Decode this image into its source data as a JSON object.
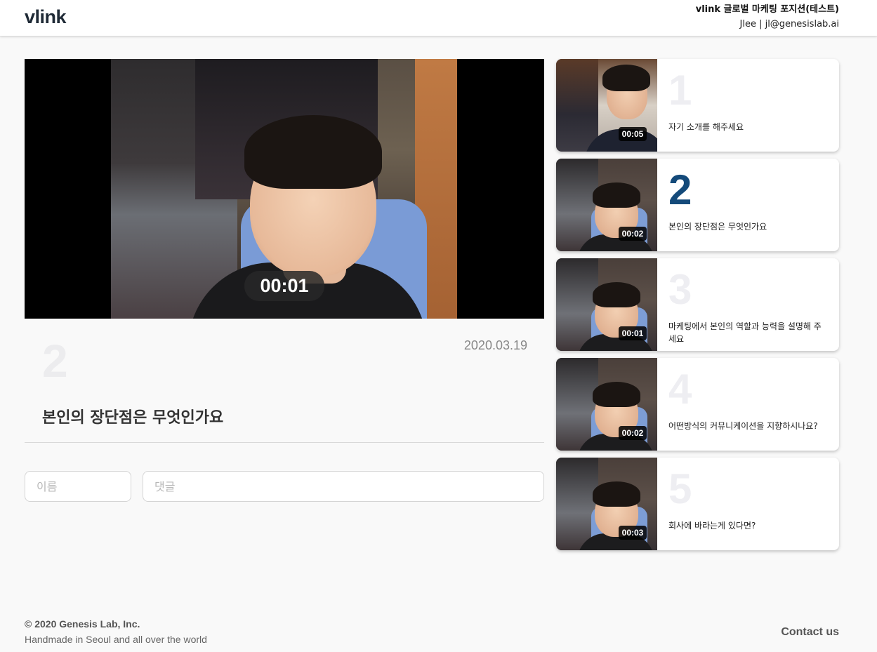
{
  "header": {
    "logo": "vlink",
    "title": "vlink 글로벌 마케팅 포지션(테스트)",
    "user": "Jlee | jl@genesislab.ai"
  },
  "player": {
    "timer": "00:01"
  },
  "question": {
    "number": "2",
    "date": "2020.03.19",
    "title": "본인의 장단점은 무엇인가요"
  },
  "comment_form": {
    "name_placeholder": "이름",
    "comment_placeholder": "댓글"
  },
  "cards": [
    {
      "number": "1",
      "duration": "00:05",
      "text": "자기 소개를 해주세요",
      "active": false
    },
    {
      "number": "2",
      "duration": "00:02",
      "text": "본인의 장단점은 무엇인가요",
      "active": true
    },
    {
      "number": "3",
      "duration": "00:01",
      "text": "마케팅에서 본인의 역할과 능력을 설명해 주세요",
      "active": false
    },
    {
      "number": "4",
      "duration": "00:02",
      "text": "어떤방식의 커뮤니케이션을 지향하시나요?",
      "active": false
    },
    {
      "number": "5",
      "duration": "00:03",
      "text": "회사에 바라는게 있다면?",
      "active": false
    }
  ],
  "footer": {
    "copyright": "© 2020 Genesis Lab, Inc.",
    "tagline": "Handmade in Seoul and all over the world",
    "contact": "Contact us"
  },
  "colors": {
    "active_number": "#144a7a",
    "inactive_number": "#eeeef2",
    "background": "#f9f9f9"
  }
}
